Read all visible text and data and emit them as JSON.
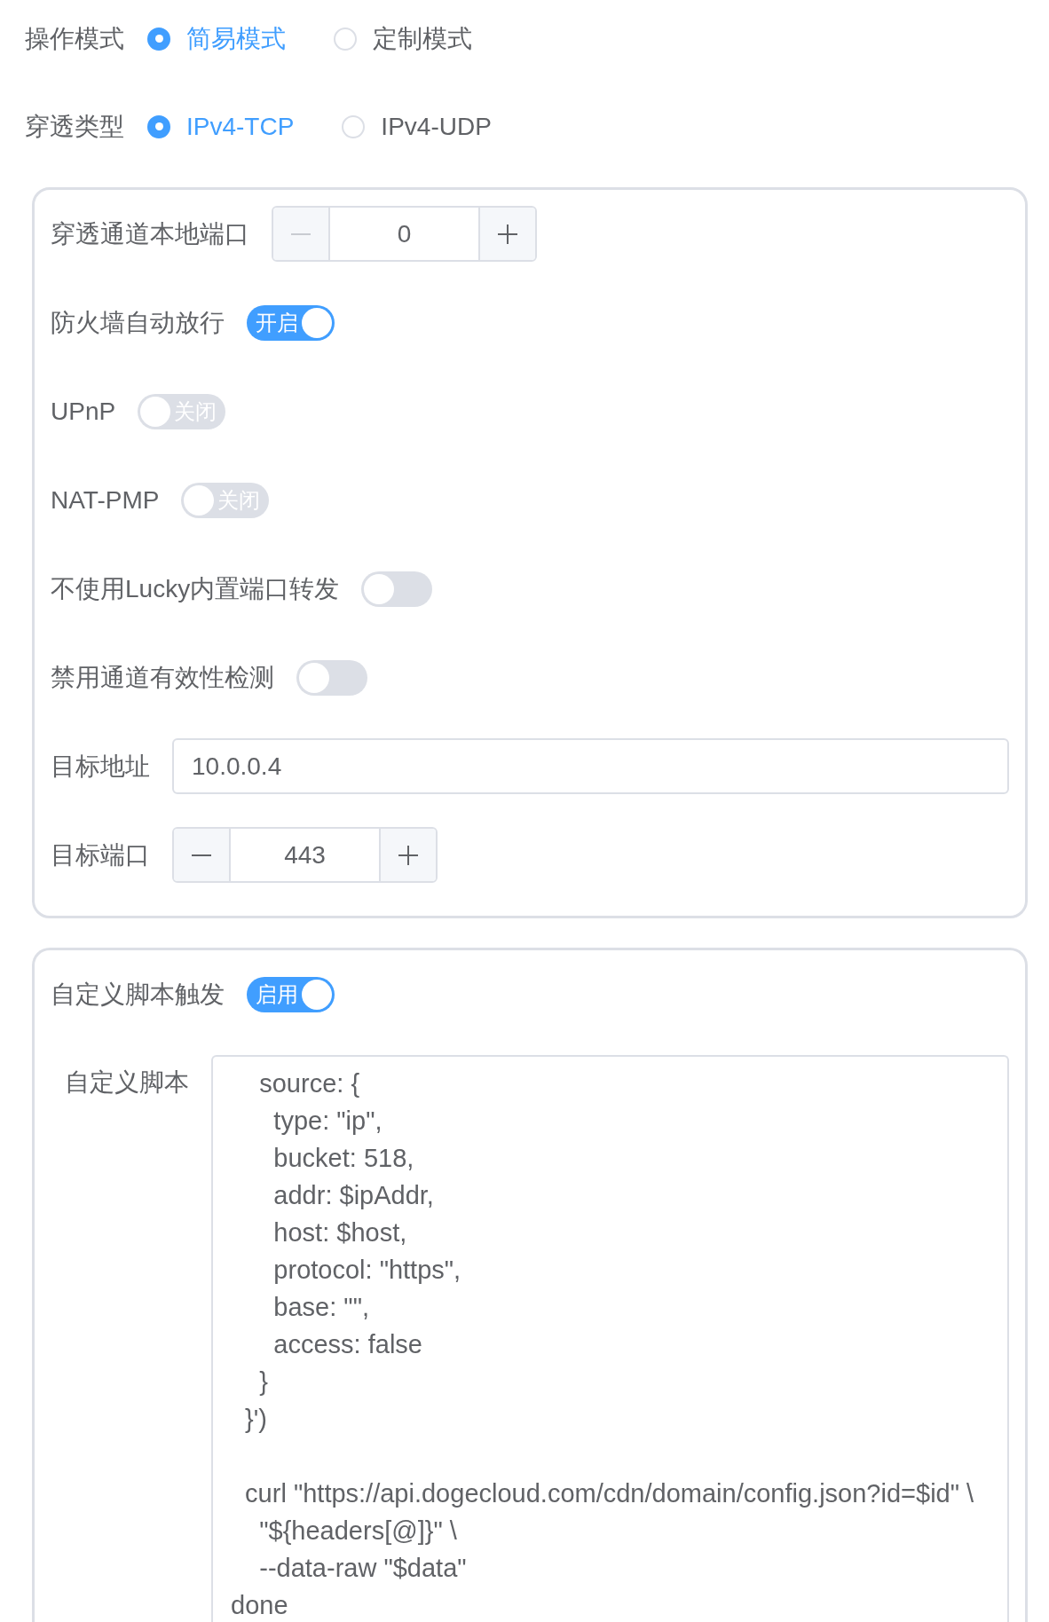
{
  "radio_groups": [
    {
      "label": "操作模式",
      "options": [
        {
          "label": "简易模式",
          "selected": true
        },
        {
          "label": "定制模式",
          "selected": false
        }
      ]
    },
    {
      "label": "穿透类型",
      "options": [
        {
          "label": "IPv4-TCP",
          "selected": true
        },
        {
          "label": "IPv4-UDP",
          "selected": false
        }
      ]
    }
  ],
  "cards": [
    {
      "fields": [
        {
          "kind": "number",
          "label": "穿透通道本地端口",
          "value": "0",
          "decrease_disabled": true
        },
        {
          "kind": "switch",
          "label": "防火墙自动放行",
          "on": true,
          "text": "开启"
        },
        {
          "kind": "switch",
          "label": "UPnP",
          "on": false,
          "text": "关闭"
        },
        {
          "kind": "switch",
          "label": "NAT-PMP",
          "on": false,
          "text": "关闭"
        },
        {
          "kind": "switch",
          "label": "不使用Lucky内置端口转发",
          "on": false
        },
        {
          "kind": "switch",
          "label": "禁用通道有效性检测",
          "on": false
        },
        {
          "kind": "text",
          "label": "目标地址",
          "value": "10.0.0.4"
        },
        {
          "kind": "number",
          "label": "目标端口",
          "value": "443",
          "decrease_disabled": false
        }
      ]
    },
    {
      "fields": [
        {
          "kind": "switch",
          "label": "自定义脚本触发",
          "on": true,
          "text": "启用"
        },
        {
          "kind": "textarea",
          "label": "自定义脚本",
          "value": "    source: {\n      type: \"ip\",\n      bucket: 518,\n      addr: $ipAddr,\n      host: $host,\n      protocol: \"https\",\n      base: \"\",\n      access: false\n    }\n  }')\n\n  curl \"https://api.dogecloud.com/cdn/domain/config.json?id=$id\" \\\n    \"${headers[@]}\" \\\n    --data-raw \"$data\"\ndone"
        }
      ]
    }
  ]
}
